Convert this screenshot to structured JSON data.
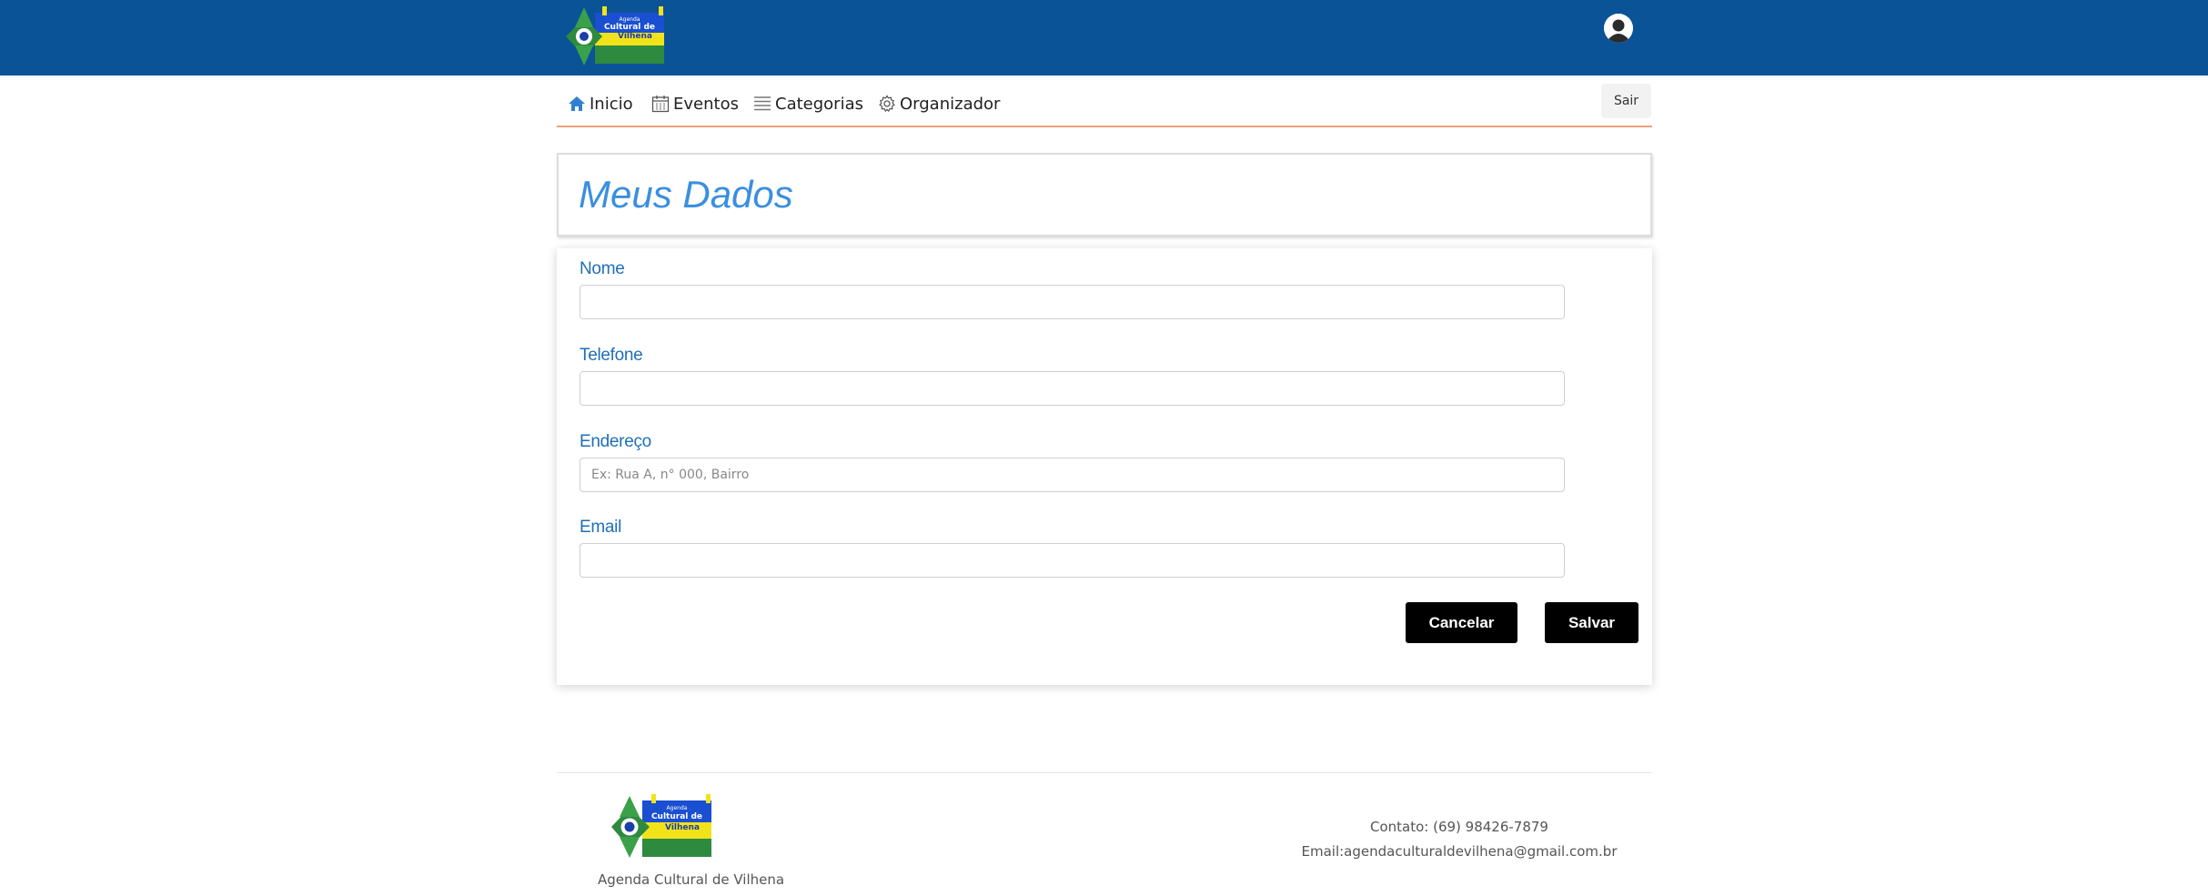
{
  "header": {
    "logo_text": "Agenda Cultural de Vilhena",
    "colors": {
      "bar": "#0a5396"
    }
  },
  "nav": {
    "items": [
      {
        "label": "Inicio",
        "icon": "home-icon"
      },
      {
        "label": "Eventos",
        "icon": "calendar-icon"
      },
      {
        "label": "Categorias",
        "icon": "list-icon"
      },
      {
        "label": "Organizador",
        "icon": "gear-icon"
      }
    ],
    "logout_label": "Sair"
  },
  "page": {
    "title": "Meus Dados"
  },
  "form": {
    "fields": [
      {
        "label": "Nome",
        "value": "",
        "placeholder": ""
      },
      {
        "label": "Telefone",
        "value": "",
        "placeholder": ""
      },
      {
        "label": "Endereço",
        "value": "",
        "placeholder": "Ex: Rua A, n° 000, Bairro"
      },
      {
        "label": "Email",
        "value": "",
        "placeholder": ""
      }
    ],
    "cancel_label": "Cancelar",
    "save_label": "Salvar"
  },
  "footer": {
    "name": "Agenda Cultural de Vilhena",
    "contact": "Contato: (69) 98426-7879",
    "email": "Email:agendaculturaldevilhena@gmail.com.br"
  }
}
